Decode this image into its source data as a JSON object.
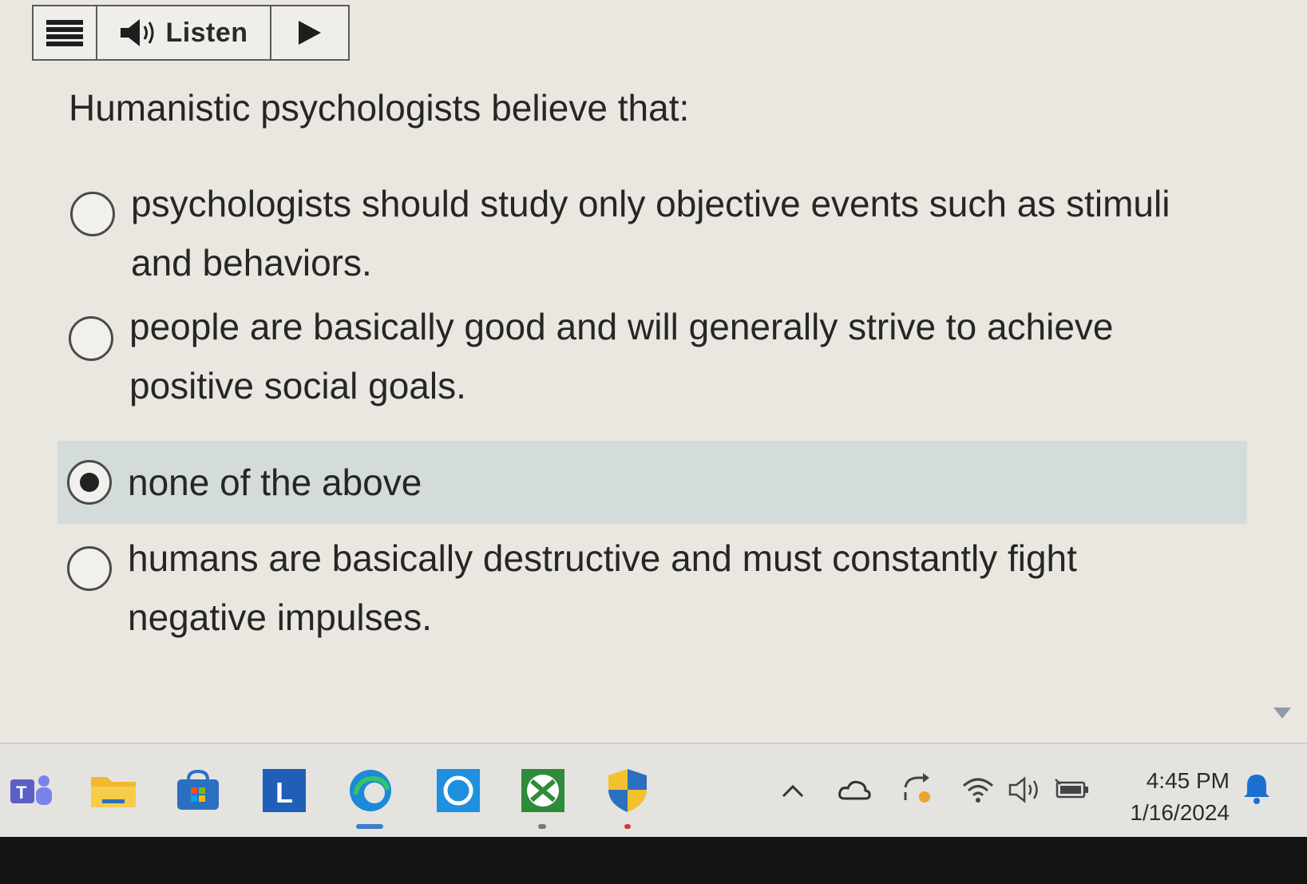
{
  "toolbar": {
    "menu_icon": "hamburger-menu-icon",
    "speaker_icon": "speaker-icon",
    "listen_label": "Listen",
    "play_icon": "play-icon"
  },
  "question": {
    "text": "Humanistic psychologists believe that:",
    "options": [
      {
        "label": "psychologists should study only objective events such as stimuli and behaviors.",
        "selected": false
      },
      {
        "label": "people are basically good and will generally strive to achieve positive social goals.",
        "selected": false
      },
      {
        "label": "none of the above",
        "selected": true
      },
      {
        "label": "humans are basically destructive and must constantly fight negative impulses.",
        "selected": false
      }
    ]
  },
  "taskbar": {
    "pinned_apps": [
      {
        "name": "teams-icon",
        "color": "#5b5fc7"
      },
      {
        "name": "file-explorer-icon",
        "color": "#f2b92f"
      },
      {
        "name": "microsoft-store-icon",
        "color": "#2b6fc1"
      },
      {
        "name": "l-app-icon",
        "letter": "L",
        "color": "#1f5fb8"
      },
      {
        "name": "edge-icon",
        "color": "#1c8ad6"
      },
      {
        "name": "cortana-icon",
        "color": "#1f8fe0"
      },
      {
        "name": "xbox-icon",
        "color": "#2e8b3a"
      },
      {
        "name": "security-shield-icon",
        "color": "#f2c12e"
      }
    ],
    "tray_icons": [
      "chevron-up-icon",
      "onedrive-cloud-icon",
      "sync-icon",
      "wifi-icon",
      "volume-icon",
      "battery-icon"
    ],
    "time": "4:45 PM",
    "date": "1/16/2024",
    "notification_icon": "notification-bell-icon"
  }
}
